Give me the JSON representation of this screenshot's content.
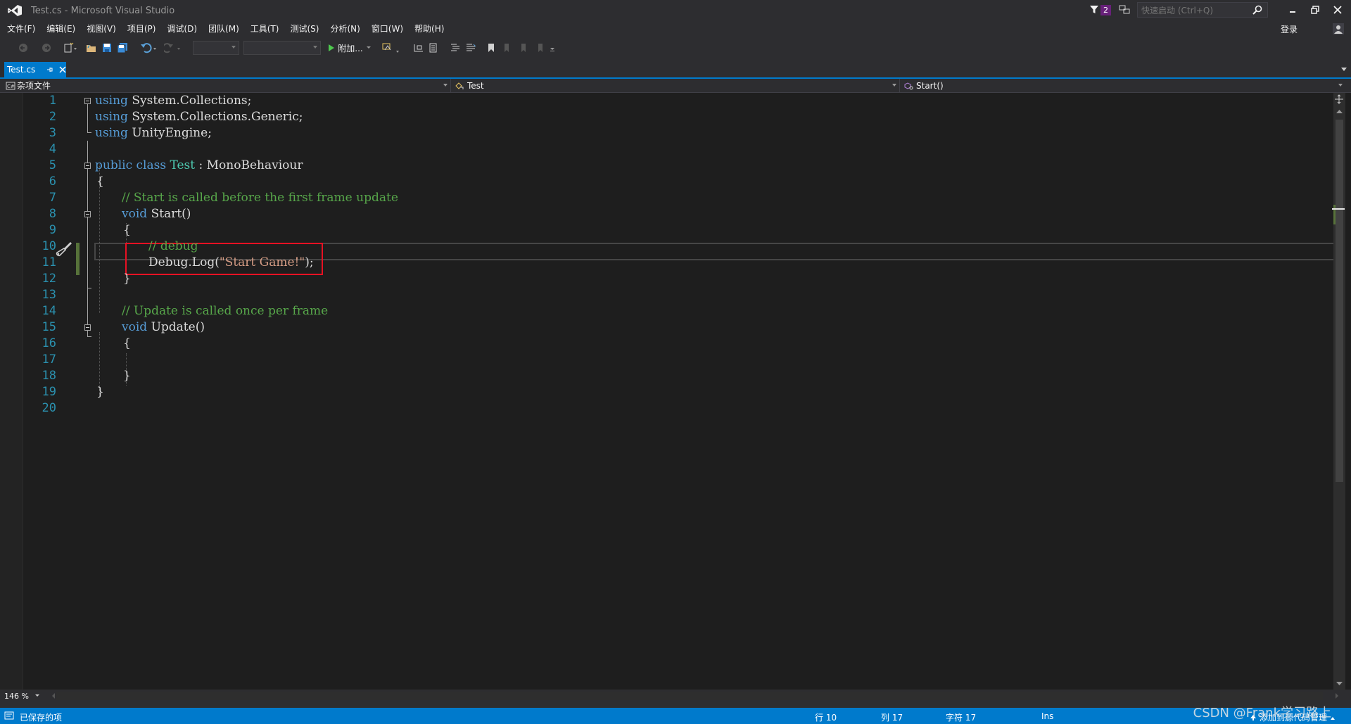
{
  "window": {
    "title": "Test.cs - Microsoft Visual Studio",
    "notification_count": "2",
    "quick_launch_placeholder": "快速启动 (Ctrl+Q)",
    "login_label": "登录"
  },
  "menu": [
    "文件(F)",
    "编辑(E)",
    "视图(V)",
    "项目(P)",
    "调试(D)",
    "团队(M)",
    "工具(T)",
    "测试(S)",
    "分析(N)",
    "窗口(W)",
    "帮助(H)"
  ],
  "toolbar": {
    "attach_label": "附加..."
  },
  "tab": {
    "label": "Test.cs"
  },
  "navbar": {
    "project": "杂项文件",
    "type": "Test",
    "member": "Start()"
  },
  "editor": {
    "line_numbers": [
      "1",
      "2",
      "3",
      "4",
      "5",
      "6",
      "7",
      "8",
      "9",
      "10",
      "11",
      "12",
      "13",
      "14",
      "15",
      "16",
      "17",
      "18",
      "19",
      "20"
    ],
    "lines": {
      "l1": {
        "kw": "using",
        "rest": " System.Collections;"
      },
      "l2": {
        "kw": "using",
        "rest": " System.Collections.Generic;"
      },
      "l3": {
        "kw": "using",
        "rest": " UnityEngine;"
      },
      "l5": {
        "kw1": "public",
        "kw2": "class",
        "type": "Test",
        "rest": " : MonoBehaviour"
      },
      "l6": "{",
      "l7": "// Start is called before the first frame update",
      "l8": {
        "kw": "void",
        "rest": " Start()"
      },
      "l9": "{",
      "l10": "// debug",
      "l11": {
        "pre": "Debug.Log(",
        "str": "\"Start Game!\"",
        "post": ");"
      },
      "l12": "}",
      "l14": "// Update is called once per frame",
      "l15": {
        "kw": "void",
        "rest": " Update()"
      },
      "l16": "{",
      "l18": "}",
      "l19": "}"
    },
    "zoom": "146 %"
  },
  "status": {
    "message": "已保存的项",
    "line": "行 10",
    "col": "列 17",
    "char": "字符 17",
    "mode": "Ins",
    "source_control": "添加到源代码管理"
  },
  "watermark": "CSDN @Frank学习路上",
  "colors": {
    "accent": "#007acc",
    "highlight_box": "#e81123",
    "keyword": "#569cd6",
    "type": "#4ec9b0",
    "comment": "#57a64a",
    "string": "#d69d85",
    "line_number": "#2b91af"
  }
}
